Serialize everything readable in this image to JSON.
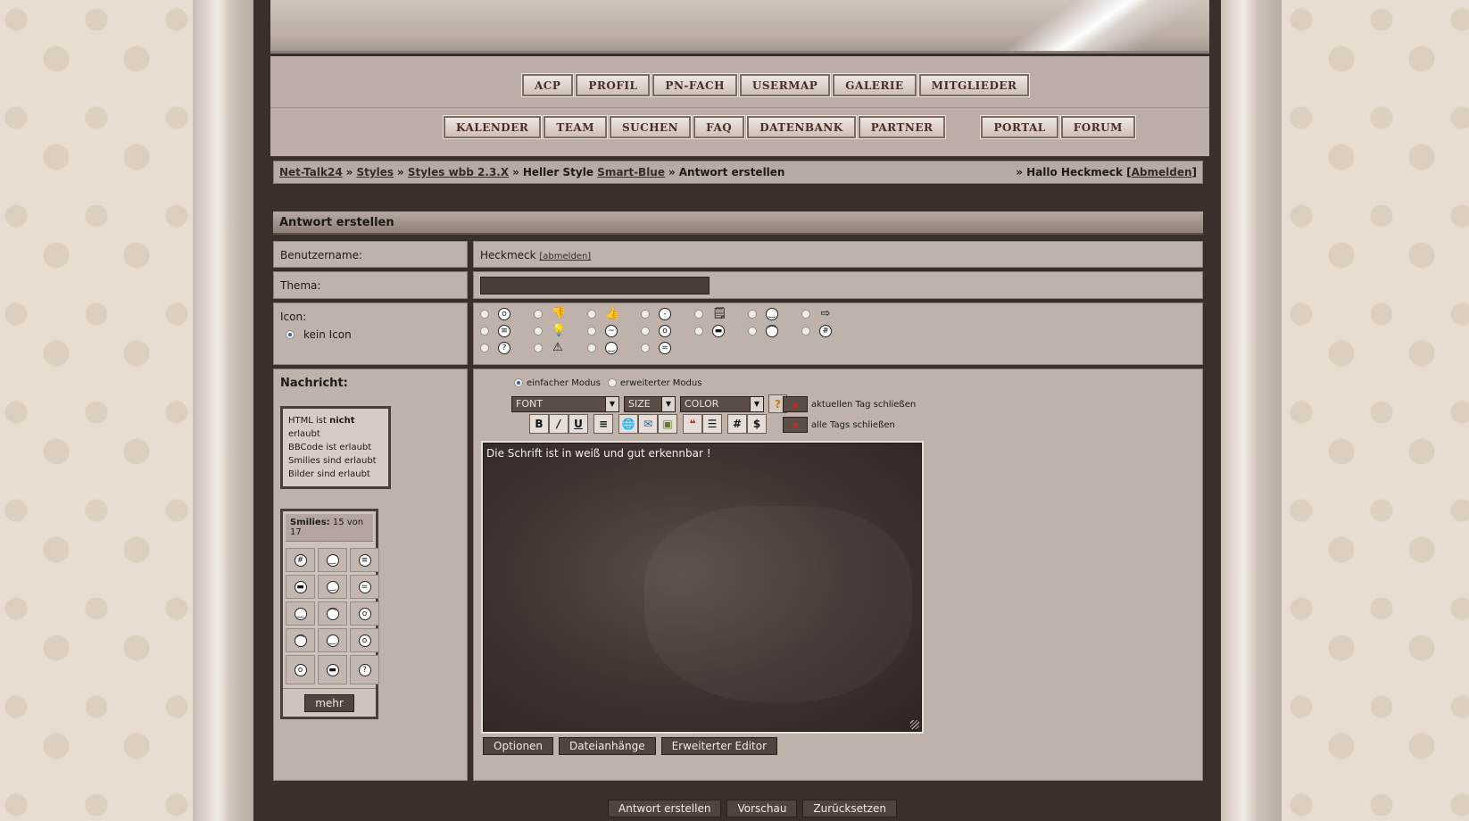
{
  "nav_row1": [
    "ACP",
    "PROFIL",
    "PN-FACH",
    "USERMAP",
    "GALERIE",
    "MITGLIEDER"
  ],
  "nav_row2": [
    "KALENDER",
    "TEAM",
    "SUCHEN",
    "FAQ",
    "DATENBANK",
    "PARTNER"
  ],
  "nav_row2_right": [
    "PORTAL",
    "FORUM"
  ],
  "breadcrumb": {
    "items": [
      "Net-Talk24",
      "Styles",
      "Styles wbb 2.3.X"
    ],
    "plain": "Heller Style",
    "link_last": "Smart-Blue",
    "current": "Antwort erstellen",
    "sep": "»",
    "greeting_prefix": "» Hallo Heckmeck [",
    "logout": "Abmelden",
    "greeting_suffix": "]"
  },
  "panel": {
    "title": "Antwort erstellen",
    "username_label": "Benutzername:",
    "username_value": "Heckmeck",
    "logout_link": "[abmelden]",
    "thema_label": "Thema:",
    "thema_value": "",
    "icon_label": "Icon:",
    "no_icon_label": "kein Icon",
    "message_label": "Nachricht:"
  },
  "rules": {
    "html_prefix": "HTML ist ",
    "html_bold": "nicht",
    "html_suffix": " erlaubt",
    "bbcode": "BBCode ist erlaubt",
    "smilies": "Smilies sind erlaubt",
    "images": "Bilder sind erlaubt"
  },
  "smilies_box": {
    "title": "Smilies:",
    "count": "15 von 17",
    "more": "mehr"
  },
  "editor": {
    "mode_simple": "einfacher Modus",
    "mode_advanced": "erweiterter Modus",
    "font": "FONT",
    "size": "SIZE",
    "color": "COLOR",
    "close_current": "aktuellen Tag schließen",
    "close_all": "alle Tags schließen",
    "text": "Die Schrift ist in weiß und gut erkennbar !",
    "btn_options": "Optionen",
    "btn_attachments": "Dateianhänge",
    "btn_advanced": "Erweiterter Editor"
  },
  "toolbar_icons": [
    "bold-icon",
    "italic-icon",
    "underline-icon",
    "center-icon",
    "url-icon",
    "email-icon",
    "image-icon",
    "quote-icon",
    "list-icon",
    "hash-icon",
    "dollar-icon"
  ],
  "submit": {
    "post": "Antwort erstellen",
    "preview": "Vorschau",
    "reset": "Zurücksetzen"
  },
  "colors": {
    "frame": "#3a2f2b",
    "panel": "#bfb2aa",
    "nav_text": "#4a2c24"
  }
}
